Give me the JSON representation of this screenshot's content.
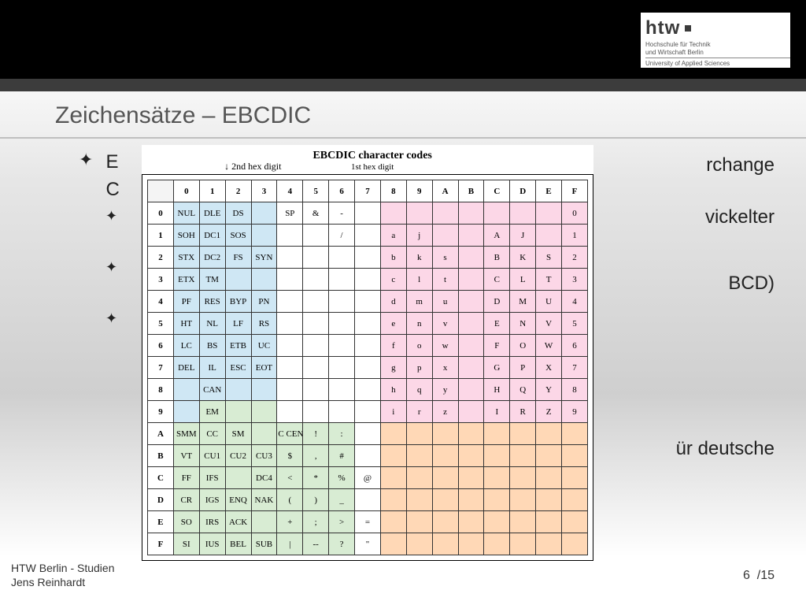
{
  "logo": {
    "brand": "htw",
    "line1": "Hochschule für Technik",
    "line2": "und Wirtschaft Berlin",
    "line3": "University of Applied Sciences"
  },
  "title": "Zeichensätze – EBCDIC",
  "bullets": {
    "main_left": "E",
    "main_right": "rchange",
    "main_next": "C",
    "sub1": "vickelter",
    "sub2": "BCD)",
    "sub3": "ür deutsche"
  },
  "footer": {
    "l1": "HTW Berlin - Studien",
    "l2": "Jens Reinhardt",
    "page_cur": "6",
    "page_sep": "/",
    "page_tot": "15"
  },
  "figure": {
    "axis_top": "2nd hex digit",
    "axis_title": "EBCDIC character codes",
    "axis_sub": "1st hex digit",
    "col_headers": [
      "0",
      "1",
      "2",
      "3",
      "4",
      "5",
      "6",
      "7",
      "8",
      "9",
      "A",
      "B",
      "C",
      "D",
      "E",
      "F"
    ],
    "row_headers": [
      "0",
      "1",
      "2",
      "3",
      "4",
      "5",
      "6",
      "7",
      "8",
      "9",
      "A",
      "B",
      "C",
      "D",
      "E",
      "F"
    ],
    "zones": {
      "comment": "zone per [row][col] index: b=blue w=white g=green p=pink o=orange"
    }
  },
  "chart_data": {
    "type": "table",
    "title": "EBCDIC character codes",
    "xlabel": "1st hex digit",
    "ylabel": "2nd hex digit",
    "col_headers": [
      "0",
      "1",
      "2",
      "3",
      "4",
      "5",
      "6",
      "7",
      "8",
      "9",
      "A",
      "B",
      "C",
      "D",
      "E",
      "F"
    ],
    "row_headers": [
      "0",
      "1",
      "2",
      "3",
      "4",
      "5",
      "6",
      "7",
      "8",
      "9",
      "A",
      "B",
      "C",
      "D",
      "E",
      "F"
    ],
    "cells": [
      [
        "NUL",
        "DLE",
        "DS",
        "",
        "SP",
        "&",
        "-",
        "",
        "",
        "",
        "",
        "",
        "",
        "",
        "",
        "0"
      ],
      [
        "SOH",
        "DC1",
        "SOS",
        "",
        "",
        "",
        "/",
        "",
        "a",
        "j",
        "",
        "",
        "A",
        "J",
        "",
        "1"
      ],
      [
        "STX",
        "DC2",
        "FS",
        "SYN",
        "",
        "",
        "",
        "",
        "b",
        "k",
        "s",
        "",
        "B",
        "K",
        "S",
        "2"
      ],
      [
        "ETX",
        "TM",
        "",
        "",
        "",
        "",
        "",
        "",
        "c",
        "l",
        "t",
        "",
        "C",
        "L",
        "T",
        "3"
      ],
      [
        "PF",
        "RES",
        "BYP",
        "PN",
        "",
        "",
        "",
        "",
        "d",
        "m",
        "u",
        "",
        "D",
        "M",
        "U",
        "4"
      ],
      [
        "HT",
        "NL",
        "LF",
        "RS",
        "",
        "",
        "",
        "",
        "e",
        "n",
        "v",
        "",
        "E",
        "N",
        "V",
        "5"
      ],
      [
        "LC",
        "BS",
        "ETB",
        "UC",
        "",
        "",
        "",
        "",
        "f",
        "o",
        "w",
        "",
        "F",
        "O",
        "W",
        "6"
      ],
      [
        "DEL",
        "IL",
        "ESC",
        "EOT",
        "",
        "",
        "",
        "",
        "g",
        "p",
        "x",
        "",
        "G",
        "P",
        "X",
        "7"
      ],
      [
        "",
        "CAN",
        "",
        "",
        "",
        "",
        "",
        "",
        "h",
        "q",
        "y",
        "",
        "H",
        "Q",
        "Y",
        "8"
      ],
      [
        "",
        "EM",
        "",
        "",
        "",
        "",
        "",
        "",
        "i",
        "r",
        "z",
        "",
        "I",
        "R",
        "Z",
        "9"
      ],
      [
        "SMM",
        "CC",
        "SM",
        "",
        "C CENT",
        "!",
        ":",
        "",
        "",
        "",
        "",
        "",
        "",
        "",
        "",
        ""
      ],
      [
        "VT",
        "CU1",
        "CU2",
        "CU3",
        "$",
        ",",
        "#",
        "",
        "",
        "",
        "",
        "",
        "",
        "",
        "",
        ""
      ],
      [
        "FF",
        "IFS",
        "",
        "DC4",
        "<",
        "*",
        "%",
        "@",
        "",
        "",
        "",
        "",
        "",
        "",
        "",
        ""
      ],
      [
        "CR",
        "IGS",
        "ENQ",
        "NAK",
        "(",
        ")",
        "_",
        "",
        "",
        "",
        "",
        "",
        "",
        "",
        "",
        ""
      ],
      [
        "SO",
        "IRS",
        "ACK",
        "",
        "+",
        ";",
        ">",
        "=",
        "",
        "",
        "",
        "",
        "",
        "",
        "",
        ""
      ],
      [
        "SI",
        "IUS",
        "BEL",
        "SUB",
        "|",
        "--",
        "?",
        "\"",
        "",
        "",
        "",
        "",
        "",
        "",
        "",
        ""
      ]
    ],
    "zone_map_rows": [
      "bbbbwwwwppppppp p",
      "bbbbwwwwppppppp p",
      "bbbbwwwwppppppp p",
      "bbbbwwwwppppppp p",
      "bbbbwwwwppppppp p",
      "bbbbwwwwppppppp p",
      "bbbbwwwwppppppp p",
      "bbbbwwwwppppppp p",
      "bbbbwwwwppppppp p",
      "bgggwwwwppppppp p",
      "gggggggwoooooooo",
      "gggggggwoooooooo",
      "gggggggwoooooooo",
      "gggggggwoooooooo",
      "gggggggwoooooooo",
      "gggggggwoooooooo"
    ]
  }
}
